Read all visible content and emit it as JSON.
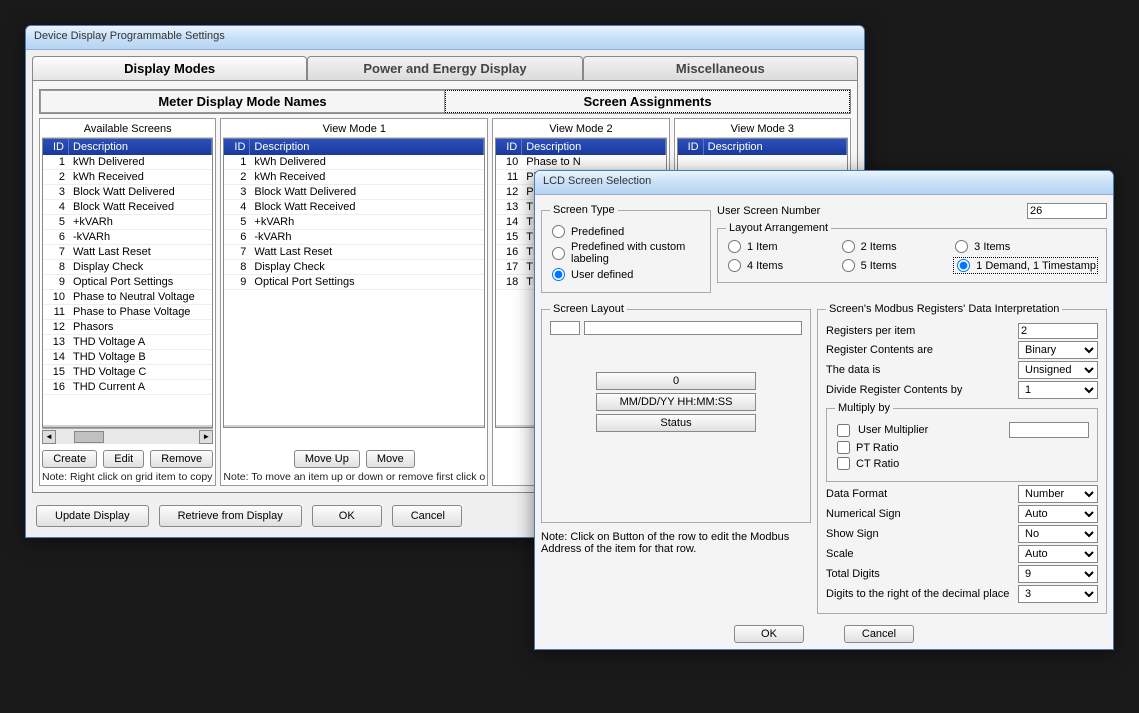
{
  "mainWindow": {
    "title": "Device Display Programmable Settings",
    "tabs": [
      "Display Modes",
      "Power and Energy Display",
      "Miscellaneous"
    ],
    "subtabs": [
      "Meter Display Mode Names",
      "Screen Assignments"
    ],
    "colTitles": [
      "Available Screens",
      "View Mode 1",
      "View Mode 2",
      "View Mode 3"
    ],
    "gridHead": {
      "id": "ID",
      "desc": "Description"
    },
    "availableScreens": [
      {
        "id": "1",
        "desc": "kWh Delivered"
      },
      {
        "id": "2",
        "desc": "kWh Received"
      },
      {
        "id": "3",
        "desc": "Block Watt Delivered"
      },
      {
        "id": "4",
        "desc": "Block Watt Received"
      },
      {
        "id": "5",
        "desc": "+kVARh"
      },
      {
        "id": "6",
        "desc": "-kVARh"
      },
      {
        "id": "7",
        "desc": "Watt Last Reset"
      },
      {
        "id": "8",
        "desc": "Display Check"
      },
      {
        "id": "9",
        "desc": "Optical Port Settings"
      },
      {
        "id": "10",
        "desc": "Phase to Neutral Voltage"
      },
      {
        "id": "11",
        "desc": "Phase to Phase Voltage"
      },
      {
        "id": "12",
        "desc": "Phasors"
      },
      {
        "id": "13",
        "desc": "THD Voltage A"
      },
      {
        "id": "14",
        "desc": "THD Voltage B"
      },
      {
        "id": "15",
        "desc": "THD Voltage C"
      },
      {
        "id": "16",
        "desc": "THD Current A"
      }
    ],
    "viewMode1": [
      {
        "id": "1",
        "desc": "kWh Delivered"
      },
      {
        "id": "2",
        "desc": "kWh Received"
      },
      {
        "id": "3",
        "desc": "Block Watt Delivered"
      },
      {
        "id": "4",
        "desc": "Block Watt Received"
      },
      {
        "id": "5",
        "desc": "+kVARh"
      },
      {
        "id": "6",
        "desc": "-kVARh"
      },
      {
        "id": "7",
        "desc": "Watt Last Reset"
      },
      {
        "id": "8",
        "desc": "Display Check"
      },
      {
        "id": "9",
        "desc": "Optical Port Settings"
      }
    ],
    "viewMode2": [
      {
        "id": "10",
        "desc": "Phase to N"
      },
      {
        "id": "11",
        "desc": "Phase to F"
      },
      {
        "id": "12",
        "desc": "Phasors"
      },
      {
        "id": "13",
        "desc": "THD Volta"
      },
      {
        "id": "14",
        "desc": "THD Volta"
      },
      {
        "id": "15",
        "desc": "THD Volta"
      },
      {
        "id": "16",
        "desc": "THD Curre"
      },
      {
        "id": "17",
        "desc": "THD Curre"
      },
      {
        "id": "18",
        "desc": "THD Curre"
      }
    ],
    "buttons": {
      "create": "Create",
      "edit": "Edit",
      "remove": "Remove",
      "moveUp": "Move Up",
      "moveDown": "Move"
    },
    "note1": "Note: Right click on grid item to copy",
    "note2": "Note: To move an item up or down or remove first click o",
    "bottom": {
      "update": "Update Display",
      "retrieve": "Retrieve from  Display",
      "ok": "OK",
      "cancel": "Cancel"
    }
  },
  "dlg": {
    "title": "LCD Screen Selection",
    "screenType": {
      "legend": "Screen Type",
      "opts": [
        "Predefined",
        "Predefined with custom labeling",
        "User defined"
      ]
    },
    "userScreenNum": {
      "label": "User Screen Number",
      "value": "26"
    },
    "layoutArr": {
      "legend": "Layout Arrangement",
      "opts": [
        "1 Item",
        "2 Items",
        "3 Items",
        "4 Items",
        "5 Items",
        "1 Demand, 1 Timestamp"
      ]
    },
    "screenLayout": {
      "legend": "Screen Layout",
      "rows": [
        "",
        "0",
        "MM/DD/YY  HH:MM:SS",
        "Status"
      ]
    },
    "layoutNote": "Note: Click on Button of the row to edit the Modbus Address of the item for that row.",
    "modbus": {
      "legend": "Screen's Modbus Registers' Data Interpretation",
      "regPerItem": {
        "label": "Registers per item",
        "value": "2"
      },
      "regContents": {
        "label": "Register Contents are",
        "value": "Binary"
      },
      "dataIs": {
        "label": "The data is",
        "value": "Unsigned"
      },
      "divide": {
        "label": "Divide Register Contents by",
        "value": "1"
      },
      "multiply": {
        "legend": "Multiply by",
        "opts": [
          "User Multiplier",
          "PT Ratio",
          "CT Ratio"
        ]
      },
      "dataFormat": {
        "label": "Data Format",
        "value": "Number"
      },
      "numSign": {
        "label": "Numerical Sign",
        "value": "Auto"
      },
      "showSign": {
        "label": "Show Sign",
        "value": "No"
      },
      "scale": {
        "label": "Scale",
        "value": "Auto"
      },
      "totalDigits": {
        "label": "Total Digits",
        "value": "9"
      },
      "decDigits": {
        "label": "Digits to the right of the decimal place",
        "value": "3"
      }
    },
    "ok": "OK",
    "cancel": "Cancel"
  }
}
